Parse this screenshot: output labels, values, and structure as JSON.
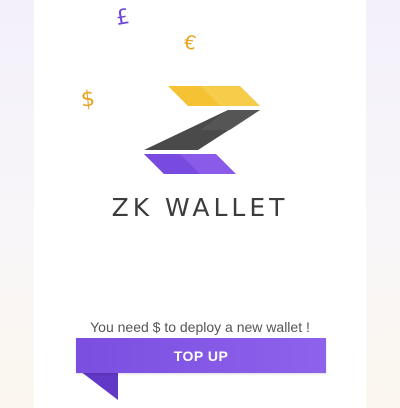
{
  "decor": {
    "pound": {
      "symbol": "£",
      "color": "#7048d8"
    },
    "euro": {
      "symbol": "€",
      "color": "#e9a21f"
    },
    "dollar": {
      "symbol": "$",
      "color": "#e9a21f"
    }
  },
  "logo": {
    "icon": "zk-logo-icon",
    "colors": {
      "top": "#f4c232",
      "middle": "#4a4a4a",
      "bottom": "#8a5ae8"
    }
  },
  "brand": {
    "name": "ZK WALLET"
  },
  "notice": {
    "text": "You need $ to deploy a new wallet !"
  },
  "topup": {
    "label": "TOP UP",
    "color": "#7f55e4",
    "tail_color": "#6238c6"
  }
}
